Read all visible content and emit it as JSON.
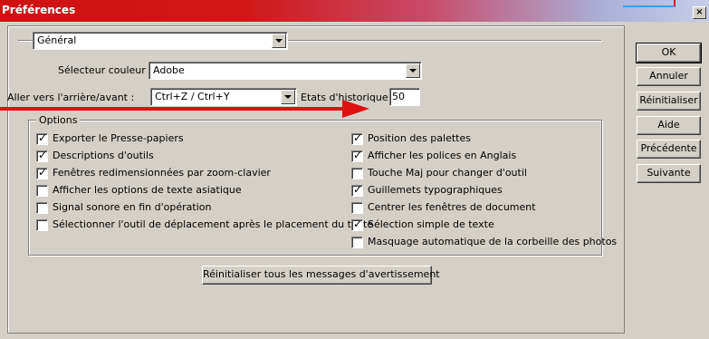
{
  "window": {
    "title": "Préférences",
    "close_glyph": "×"
  },
  "section_select": {
    "value": "Général"
  },
  "color_picker": {
    "label": "Sélecteur couleur :",
    "value": "Adobe"
  },
  "undo_redo": {
    "label": "Aller vers l'arrière/avant :",
    "value": "Ctrl+Z / Ctrl+Y"
  },
  "history": {
    "label": "Etats d'historique :",
    "value": "50"
  },
  "options": {
    "legend": "Options",
    "left": [
      {
        "label": "Exporter le Presse-papiers",
        "checked": true
      },
      {
        "label": "Descriptions d'outils",
        "checked": true
      },
      {
        "label": "Fenêtres redimensionnées par zoom-clavier",
        "checked": true
      },
      {
        "label": "Afficher les options de texte asiatique",
        "checked": false
      },
      {
        "label": "Signal sonore en fin d'opération",
        "checked": false
      },
      {
        "label": "Sélectionner l'outil de déplacement après le placement du texte",
        "checked": false
      }
    ],
    "right": [
      {
        "label": "Position des palettes",
        "checked": true
      },
      {
        "label": "Afficher les polices en Anglais",
        "checked": true
      },
      {
        "label": "Touche Maj pour changer d'outil",
        "checked": false
      },
      {
        "label": "Guillemets typographiques",
        "checked": true
      },
      {
        "label": "Centrer les fenêtres de document",
        "checked": false
      },
      {
        "label": "Sélection simple de texte",
        "checked": true
      },
      {
        "label": "Masquage automatique de la corbeille des photos",
        "checked": false
      }
    ]
  },
  "reset_warnings": {
    "label": "Réinitialiser tous les messages d'avertissement"
  },
  "side_buttons": {
    "ok": "OK",
    "cancel": "Annuler",
    "reset": "Réinitialiser",
    "help": "Aide",
    "prev": "Précédente",
    "next": "Suivante"
  },
  "colors": {
    "arrow": "#e01010",
    "title_start": "#d01010",
    "title_end": "#c8cde8"
  }
}
